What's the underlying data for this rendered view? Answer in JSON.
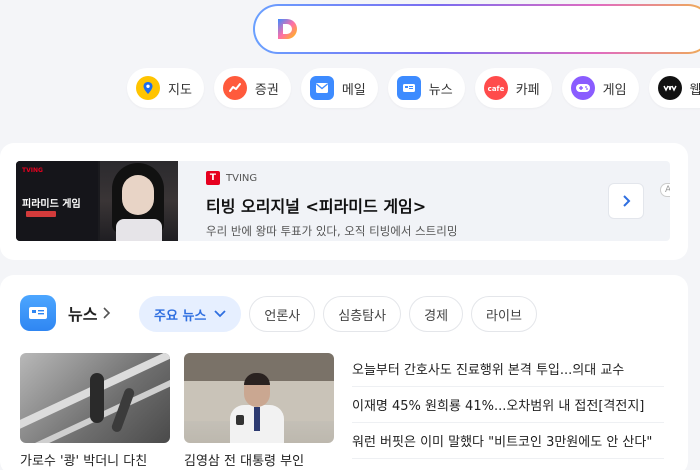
{
  "search": {
    "placeholder": "",
    "value": ""
  },
  "services": [
    {
      "label": "지도",
      "icon": "map-pin-icon",
      "color": "#ffc400"
    },
    {
      "label": "증권",
      "icon": "stock-chart-icon",
      "color": "#ff5a3c"
    },
    {
      "label": "메일",
      "icon": "mail-icon",
      "color": "#3d8bff"
    },
    {
      "label": "뉴스",
      "icon": "news-icon",
      "color": "#3d8bff"
    },
    {
      "label": "카페",
      "icon": "cafe-icon",
      "color": "#ff4b4b"
    },
    {
      "label": "게임",
      "icon": "gamepad-icon",
      "color": "#8a5cff"
    },
    {
      "label": "웹툰",
      "icon": "webtoon-icon",
      "color": "#111111"
    }
  ],
  "ad": {
    "brand": "TVING",
    "logo_letter": "T",
    "title": "티빙 오리지널 <피라미드 게임>",
    "description": "우리 반에 왕따 투표가 있다, 오직 티빙에서 스트리밍",
    "badge": "AD",
    "poster_brand": "TVING",
    "poster_title": "피라미드 게임"
  },
  "news": {
    "title": "뉴스",
    "tabs": [
      {
        "label": "주요 뉴스",
        "active": true
      },
      {
        "label": "언론사",
        "active": false
      },
      {
        "label": "심층탐사",
        "active": false
      },
      {
        "label": "경제",
        "active": false
      },
      {
        "label": "라이브",
        "active": false
      }
    ],
    "thumbs": [
      {
        "caption": "가로수 '쾅' 박더니 다친"
      },
      {
        "caption": "김영삼 전 대통령 부인"
      }
    ],
    "headlines": [
      "오늘부터 간호사도 진료행위 본격 투입...의대 교수",
      "이재명 45% 원희룡 41%...오차범위 내 접전[격전지]",
      "워런 버핏은 이미 말했다 \"비트코인 3만원에도 안 산다\""
    ]
  },
  "colors": {
    "accent": "#2f6fe0",
    "tving": "#e6001f"
  }
}
